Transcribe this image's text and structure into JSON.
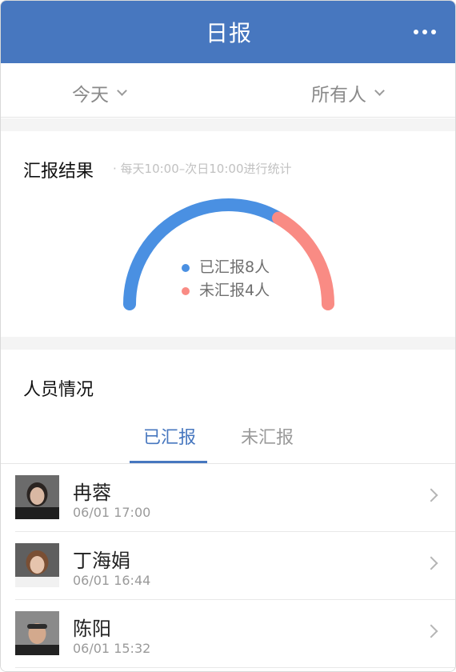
{
  "header": {
    "title": "日报",
    "more_icon": "more-horizontal-icon"
  },
  "filters": {
    "date": {
      "label": "今天",
      "icon": "chevron-down-icon"
    },
    "people": {
      "label": "所有人",
      "icon": "chevron-down-icon"
    }
  },
  "report_result": {
    "title": "汇报结果",
    "subtitle": "· 每天10:00–次日10:00进行统计",
    "reported": {
      "label": "已汇报8人",
      "count": 8,
      "color": "#4a90e2"
    },
    "unreported": {
      "label": "未汇报4人",
      "count": 4,
      "color": "#f98b84"
    }
  },
  "personnel": {
    "title": "人员情况",
    "tabs": [
      {
        "label": "已汇报",
        "active": true
      },
      {
        "label": "未汇报",
        "active": false
      }
    ],
    "items": [
      {
        "name": "冉蓉",
        "time": "06/01 17:00",
        "avatar_icon": "avatar"
      },
      {
        "name": "丁海娟",
        "time": "06/01 16:44",
        "avatar_icon": "avatar"
      },
      {
        "name": "陈阳",
        "time": "06/01 15:32",
        "avatar_icon": "avatar"
      }
    ]
  },
  "colors": {
    "accent": "#4777bf",
    "reported": "#4a90e2",
    "unreported": "#f98b84"
  }
}
